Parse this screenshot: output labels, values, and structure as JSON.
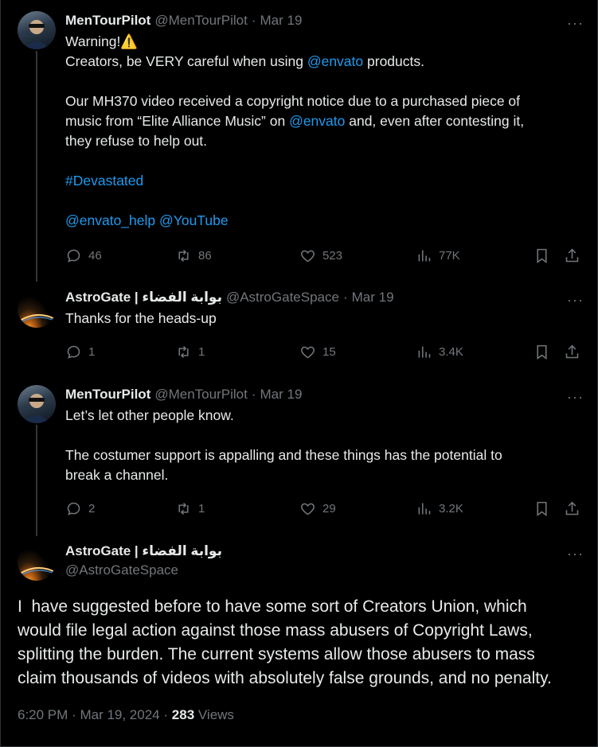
{
  "tweets": [
    {
      "name": "MenTourPilot",
      "handle": "@MenTourPilot",
      "date": "Mar 19",
      "lines": [
        {
          "parts": [
            {
              "t": "Warning!⚠️",
              "link": false
            }
          ]
        },
        {
          "parts": [
            {
              "t": "Creators, be VERY careful when using ",
              "link": false
            },
            {
              "t": "@envato",
              "link": true
            },
            {
              "t": " products.",
              "link": false
            }
          ]
        },
        {
          "parts": [
            {
              "t": " ",
              "link": false
            }
          ]
        },
        {
          "parts": [
            {
              "t": "Our MH370 video received a copyright notice due to a purchased piece of",
              "link": false
            }
          ]
        },
        {
          "parts": [
            {
              "t": "music from “Elite Alliance Music” on ",
              "link": false
            },
            {
              "t": "@envato",
              "link": true
            },
            {
              "t": " and, even after contesting it,",
              "link": false
            }
          ]
        },
        {
          "parts": [
            {
              "t": "they refuse to help out.",
              "link": false
            }
          ]
        },
        {
          "parts": [
            {
              "t": " ",
              "link": false
            }
          ]
        },
        {
          "parts": [
            {
              "t": "#Devastated",
              "link": true
            }
          ]
        },
        {
          "parts": [
            {
              "t": " ",
              "link": false
            }
          ]
        },
        {
          "parts": [
            {
              "t": "@envato_help",
              "link": true
            },
            {
              "t": " ",
              "link": false
            },
            {
              "t": "@YouTube",
              "link": true
            }
          ]
        }
      ],
      "replies": "46",
      "retweets": "86",
      "likes": "523",
      "views": "77K"
    },
    {
      "name": "AstroGate | بوابة الفضاء",
      "handle": "@AstroGateSpace",
      "date": "Mar 19",
      "lines": [
        {
          "parts": [
            {
              "t": "Thanks for the heads-up",
              "link": false
            }
          ]
        }
      ],
      "replies": "1",
      "retweets": "1",
      "likes": "15",
      "views": "3.4K"
    },
    {
      "name": "MenTourPilot",
      "handle": "@MenTourPilot",
      "date": "Mar 19",
      "lines": [
        {
          "parts": [
            {
              "t": "Let’s let other people know.",
              "link": false
            }
          ]
        },
        {
          "parts": [
            {
              "t": " ",
              "link": false
            }
          ]
        },
        {
          "parts": [
            {
              "t": "The costumer support is appalling and these things has the potential to",
              "link": false
            }
          ]
        },
        {
          "parts": [
            {
              "t": "break a channel.",
              "link": false
            }
          ]
        }
      ],
      "replies": "2",
      "retweets": "1",
      "likes": "29",
      "views": "3.2K"
    }
  ],
  "focused": {
    "name": "AstroGate | بوابة الفضاء",
    "handle": "@AstroGateSpace",
    "body_lines": [
      "I  have suggested before to have some sort of Creators Union, which",
      "would file legal action against those mass abusers of Copyright Laws,",
      "splitting the burden. The current systems allow those abusers to mass",
      "claim thousands of videos with absolutely false grounds, and no penalty."
    ],
    "time": "6:20 PM",
    "full_date": "Mar 19, 2024",
    "views_count": "283",
    "views_label": "Views"
  },
  "ui": {
    "separator": "·",
    "more": "···"
  },
  "icons": [
    "reply-icon",
    "retweet-icon",
    "like-icon",
    "views-icon",
    "bookmark-icon",
    "share-icon",
    "more-icon"
  ],
  "colors": {
    "background": "#000000",
    "text": "#e7e9ea",
    "muted": "#71767b",
    "link": "#1d9bf0",
    "thread_line": "#333639"
  }
}
